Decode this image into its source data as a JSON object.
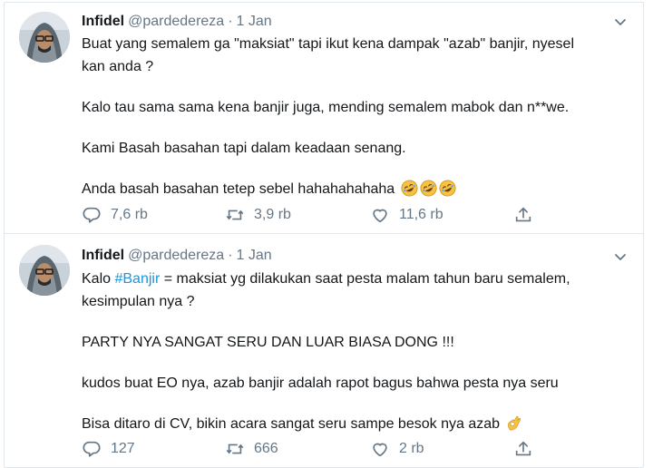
{
  "tweets": [
    {
      "author_name": "Infidel",
      "handle": "@pardedereza",
      "separator": "·",
      "date": "1 Jan",
      "lines": [
        "Buat yang semalem ga \"maksiat\" tapi ikut kena dampak \"azab\" banjir, nyesel",
        "kan anda ?",
        "Kalo tau sama sama kena banjir juga, mending semalem mabok dan n**we.",
        "Kami Basah basahan tapi dalam keadaan senang.",
        "Anda basah basahan tetep sebel hahahahahaha"
      ],
      "emoji": [
        "rolling-on-floor-laughing",
        "rolling-on-floor-laughing",
        "rolling-on-floor-laughing"
      ],
      "reply_count": "7,6 rb",
      "retweet_count": "3,9 rb",
      "like_count": "11,6 rb"
    },
    {
      "author_name": "Infidel",
      "handle": "@pardedereza",
      "separator": "·",
      "date": "1 Jan",
      "line1_prefix": "Kalo ",
      "hashtag": "#Banjir",
      "line1_suffix": " = maksiat yg dilakukan saat pesta malam tahun baru semalem,",
      "lines": [
        "kesimpulan nya ?",
        "PARTY NYA SANGAT SERU DAN LUAR BIASA DONG !!!",
        "kudos buat EO nya, azab banjir adalah rapot bagus bahwa pesta nya seru",
        "Bisa ditaro di CV, bikin acara sangat seru sampe besok nya azab"
      ],
      "emoji": [
        "ok-hand"
      ],
      "reply_count": "127",
      "retweet_count": "666",
      "like_count": "2 rb"
    }
  ],
  "colors": {
    "text": "#14171a",
    "secondary": "#657786",
    "link": "#1b95e0",
    "border": "#e1e8ed"
  },
  "icons": [
    "reply-icon",
    "retweet-icon",
    "like-icon",
    "share-icon",
    "caret-down-icon"
  ]
}
